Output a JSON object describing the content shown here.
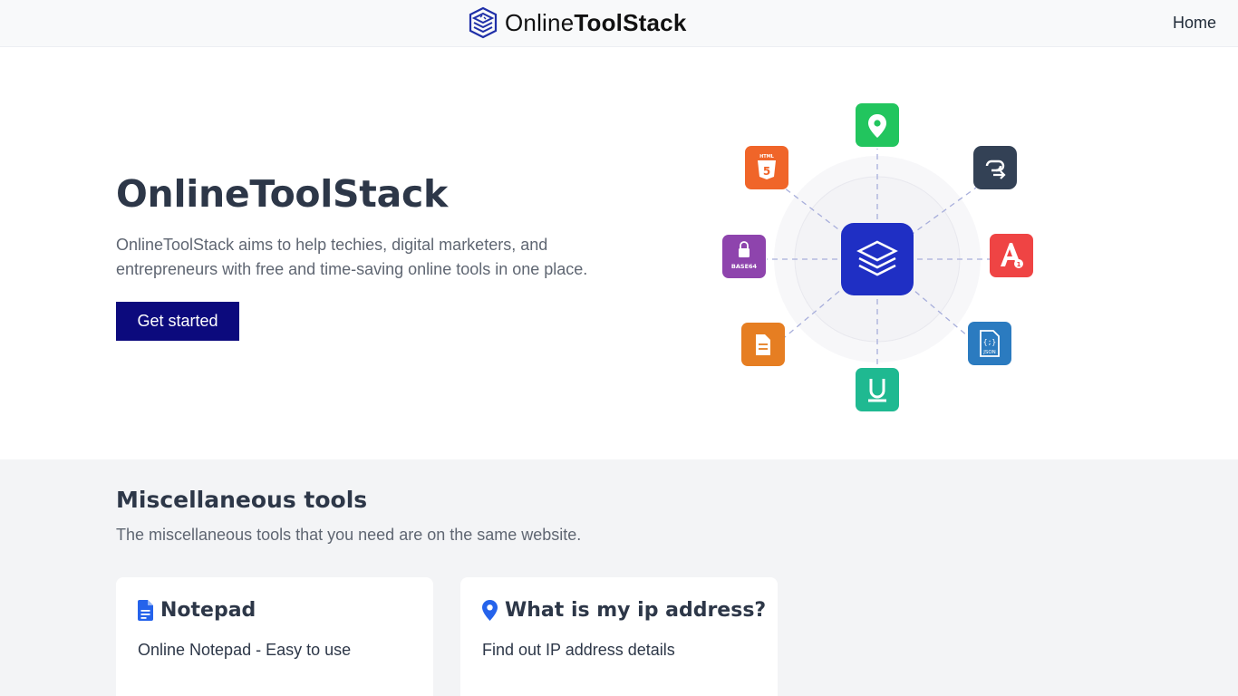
{
  "header": {
    "logo_light": "Online",
    "logo_bold": "ToolStack",
    "nav_home": "Home"
  },
  "hero": {
    "title": "OnlineToolStack",
    "description": "OnlineToolStack aims to help techies, digital marketers, and entrepreneurs with free and time-saving online tools in one place.",
    "cta_label": "Get started",
    "illustration_icons": [
      {
        "name": "location-pin-icon",
        "color": "#22c55e"
      },
      {
        "name": "link-redirect-icon",
        "color": "#334155"
      },
      {
        "name": "font-size-icon",
        "color": "#ef4444"
      },
      {
        "name": "json-file-icon",
        "color": "#2b7bc0"
      },
      {
        "name": "underline-icon",
        "color": "#1fb991"
      },
      {
        "name": "document-icon",
        "color": "#e67e22"
      },
      {
        "name": "base64-lock-icon",
        "color": "#8e44ad",
        "label": "BASE64"
      },
      {
        "name": "html5-icon",
        "color": "#f06529",
        "label": "HTML"
      }
    ],
    "center_color": "#1f2fc4"
  },
  "tools_section": {
    "title": "Miscellaneous tools",
    "subtitle": "The miscellaneous tools that you need are on the same website.",
    "cards": [
      {
        "title": "Notepad",
        "description": "Online Notepad - Easy to use",
        "icon": "document-icon",
        "icon_color": "#2563eb"
      },
      {
        "title": "What is my ip address?",
        "description": "Find out IP address details",
        "icon": "location-pin-icon",
        "icon_color": "#2563eb"
      }
    ]
  },
  "colors": {
    "primary": "#0c0a7d",
    "heading": "#2d3748",
    "muted": "#5f6672"
  }
}
